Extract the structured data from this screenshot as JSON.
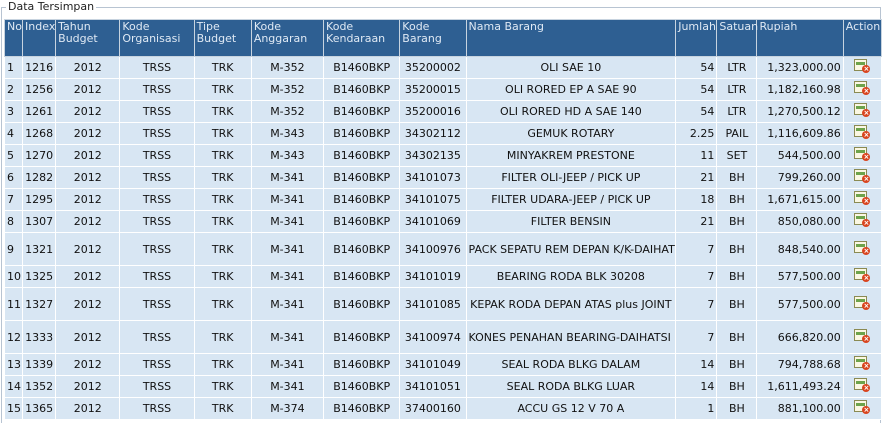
{
  "panel_title": "Data Tersimpan",
  "columns": [
    "No",
    "Index",
    "Tahun Budget",
    "Kode Organisasi",
    "Tipe Budget",
    "Kode Anggaran",
    "Kode Kendaraan",
    "Kode Barang",
    "Nama Barang",
    "Jumlah",
    "Satuan",
    "Rupiah",
    "Action"
  ],
  "rows": [
    {
      "no": "1",
      "index": "1216",
      "tahun": "2012",
      "org": "TRSS",
      "tipe": "TRK",
      "anggaran": "M-352",
      "kendaraan": "B1460BKP",
      "kode_barang": "35200002",
      "nama": "OLI SAE 10",
      "jumlah": "54",
      "satuan": "LTR",
      "rupiah": "1,323,000.00"
    },
    {
      "no": "2",
      "index": "1256",
      "tahun": "2012",
      "org": "TRSS",
      "tipe": "TRK",
      "anggaran": "M-352",
      "kendaraan": "B1460BKP",
      "kode_barang": "35200015",
      "nama": "OLI RORED EP A SAE 90",
      "jumlah": "54",
      "satuan": "LTR",
      "rupiah": "1,182,160.98"
    },
    {
      "no": "3",
      "index": "1261",
      "tahun": "2012",
      "org": "TRSS",
      "tipe": "TRK",
      "anggaran": "M-352",
      "kendaraan": "B1460BKP",
      "kode_barang": "35200016",
      "nama": "OLI RORED HD A SAE 140",
      "jumlah": "54",
      "satuan": "LTR",
      "rupiah": "1,270,500.12"
    },
    {
      "no": "4",
      "index": "1268",
      "tahun": "2012",
      "org": "TRSS",
      "tipe": "TRK",
      "anggaran": "M-343",
      "kendaraan": "B1460BKP",
      "kode_barang": "34302112",
      "nama": "GEMUK ROTARY",
      "jumlah": "2.25",
      "satuan": "PAIL",
      "rupiah": "1,116,609.86"
    },
    {
      "no": "5",
      "index": "1270",
      "tahun": "2012",
      "org": "TRSS",
      "tipe": "TRK",
      "anggaran": "M-343",
      "kendaraan": "B1460BKP",
      "kode_barang": "34302135",
      "nama": "MINYAKREM PRESTONE",
      "jumlah": "11",
      "satuan": "SET",
      "rupiah": "544,500.00"
    },
    {
      "no": "6",
      "index": "1282",
      "tahun": "2012",
      "org": "TRSS",
      "tipe": "TRK",
      "anggaran": "M-341",
      "kendaraan": "B1460BKP",
      "kode_barang": "34101073",
      "nama": "FILTER OLI-JEEP / PICK UP",
      "jumlah": "21",
      "satuan": "BH",
      "rupiah": "799,260.00"
    },
    {
      "no": "7",
      "index": "1295",
      "tahun": "2012",
      "org": "TRSS",
      "tipe": "TRK",
      "anggaran": "M-341",
      "kendaraan": "B1460BKP",
      "kode_barang": "34101075",
      "nama": "FILTER UDARA-JEEP / PICK UP",
      "jumlah": "18",
      "satuan": "BH",
      "rupiah": "1,671,615.00"
    },
    {
      "no": "8",
      "index": "1307",
      "tahun": "2012",
      "org": "TRSS",
      "tipe": "TRK",
      "anggaran": "M-341",
      "kendaraan": "B1460BKP",
      "kode_barang": "34101069",
      "nama": "FILTER BENSIN",
      "jumlah": "21",
      "satuan": "BH",
      "rupiah": "850,080.00"
    },
    {
      "no": "9",
      "index": "1321",
      "tahun": "2012",
      "org": "TRSS",
      "tipe": "TRK",
      "anggaran": "M-341",
      "kendaraan": "B1460BKP",
      "kode_barang": "34100976",
      "nama": "PACK SEPATU REM DEPAN K/K-DAIHATSI HILINE PICK UP",
      "jumlah": "7",
      "satuan": "BH",
      "rupiah": "848,540.00"
    },
    {
      "no": "10",
      "index": "1325",
      "tahun": "2012",
      "org": "TRSS",
      "tipe": "TRK",
      "anggaran": "M-341",
      "kendaraan": "B1460BKP",
      "kode_barang": "34101019",
      "nama": "BEARING RODA BLK 30208",
      "jumlah": "7",
      "satuan": "BH",
      "rupiah": "577,500.00"
    },
    {
      "no": "11",
      "index": "1327",
      "tahun": "2012",
      "org": "TRSS",
      "tipe": "TRK",
      "anggaran": "M-341",
      "kendaraan": "B1460BKP",
      "kode_barang": "34101085",
      "nama": "KEPAK RODA DEPAN ATAS plus JOINT",
      "jumlah": "7",
      "satuan": "BH",
      "rupiah": "577,500.00"
    },
    {
      "no": "12",
      "index": "1333",
      "tahun": "2012",
      "org": "TRSS",
      "tipe": "TRK",
      "anggaran": "M-341",
      "kendaraan": "B1460BKP",
      "kode_barang": "34100974",
      "nama": "KONES PENAHAN BEARING-DAIHATSI HILINE PICK UP",
      "jumlah": "7",
      "satuan": "BH",
      "rupiah": "666,820.00"
    },
    {
      "no": "13",
      "index": "1339",
      "tahun": "2012",
      "org": "TRSS",
      "tipe": "TRK",
      "anggaran": "M-341",
      "kendaraan": "B1460BKP",
      "kode_barang": "34101049",
      "nama": "SEAL RODA BLKG DALAM",
      "jumlah": "14",
      "satuan": "BH",
      "rupiah": "794,788.68"
    },
    {
      "no": "14",
      "index": "1352",
      "tahun": "2012",
      "org": "TRSS",
      "tipe": "TRK",
      "anggaran": "M-341",
      "kendaraan": "B1460BKP",
      "kode_barang": "34101051",
      "nama": "SEAL RODA BLKG LUAR",
      "jumlah": "14",
      "satuan": "BH",
      "rupiah": "1,611,493.24"
    },
    {
      "no": "15",
      "index": "1365",
      "tahun": "2012",
      "org": "TRSS",
      "tipe": "TRK",
      "anggaran": "M-374",
      "kendaraan": "B1460BKP",
      "kode_barang": "37400160",
      "nama": "ACCU GS 12 V 70 A",
      "jumlah": "1",
      "satuan": "BH",
      "rupiah": "881,100.00"
    }
  ],
  "action_icon": "delete-record-icon",
  "colors": {
    "header_bg": "#2e5f92",
    "row_bg": "#d8e6f3"
  }
}
